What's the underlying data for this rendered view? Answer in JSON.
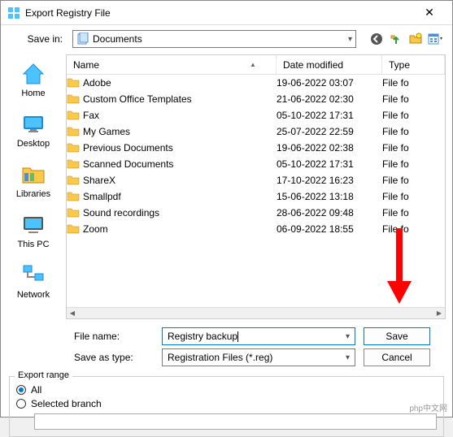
{
  "titlebar": {
    "title": "Export Registry File"
  },
  "savein": {
    "label": "Save in:",
    "value": "Documents"
  },
  "columns": {
    "name": "Name",
    "date": "Date modified",
    "type": "Type"
  },
  "sidebar": {
    "home": "Home",
    "desktop": "Desktop",
    "libraries": "Libraries",
    "thispc": "This PC",
    "network": "Network"
  },
  "files": [
    {
      "name": "Adobe",
      "date": "19-06-2022 03:07",
      "type": "File fo"
    },
    {
      "name": "Custom Office Templates",
      "date": "21-06-2022 02:30",
      "type": "File fo"
    },
    {
      "name": "Fax",
      "date": "05-10-2022 17:31",
      "type": "File fo"
    },
    {
      "name": "My Games",
      "date": "25-07-2022 22:59",
      "type": "File fo"
    },
    {
      "name": "Previous Documents",
      "date": "19-06-2022 02:38",
      "type": "File fo"
    },
    {
      "name": "Scanned Documents",
      "date": "05-10-2022 17:31",
      "type": "File fo"
    },
    {
      "name": "ShareX",
      "date": "17-10-2022 16:23",
      "type": "File fo"
    },
    {
      "name": "Smallpdf",
      "date": "15-06-2022 13:18",
      "type": "File fo"
    },
    {
      "name": "Sound recordings",
      "date": "28-06-2022 09:48",
      "type": "File fo"
    },
    {
      "name": "Zoom",
      "date": "06-09-2022 18:55",
      "type": "File fo"
    }
  ],
  "form": {
    "filename_label": "File name:",
    "filename_value": "Registry backup",
    "saveastype_label": "Save as type:",
    "saveastype_value": "Registration Files (*.reg)",
    "save_btn": "Save",
    "cancel_btn": "Cancel"
  },
  "export": {
    "legend": "Export range",
    "all": "All",
    "selected": "Selected branch",
    "branch_value": ""
  },
  "watermark": "php中文网"
}
